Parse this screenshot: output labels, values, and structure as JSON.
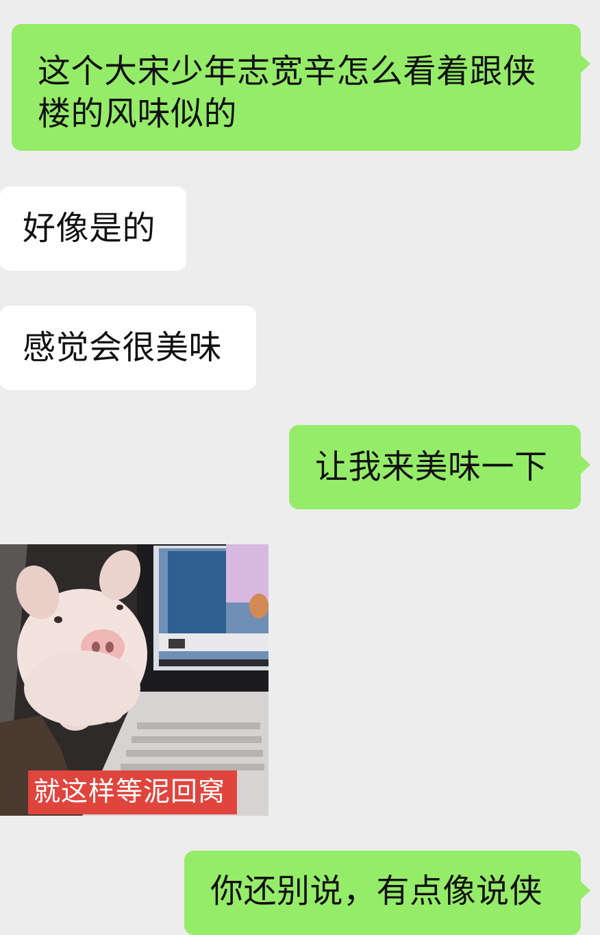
{
  "messages": [
    {
      "id": "m1",
      "side": "out",
      "text": "这个大宋少年志宽辛怎么看着跟侠楼的风味似的"
    },
    {
      "id": "m2",
      "side": "in",
      "text": "好像是的"
    },
    {
      "id": "m3",
      "side": "in",
      "text": "感觉会很美味"
    },
    {
      "id": "m4",
      "side": "out",
      "text": "让我来美味一下"
    },
    {
      "id": "m5",
      "side": "in",
      "type": "image",
      "description_icon": "pig-meme-image",
      "caption": "就这样等泥回窝"
    },
    {
      "id": "m6",
      "side": "out",
      "text": "你还别说，有点像说侠"
    }
  ],
  "colors": {
    "background": "#ededed",
    "outgoing_bubble": "#95ec69",
    "incoming_bubble": "#ffffff",
    "caption_bg": "#e0453d"
  }
}
